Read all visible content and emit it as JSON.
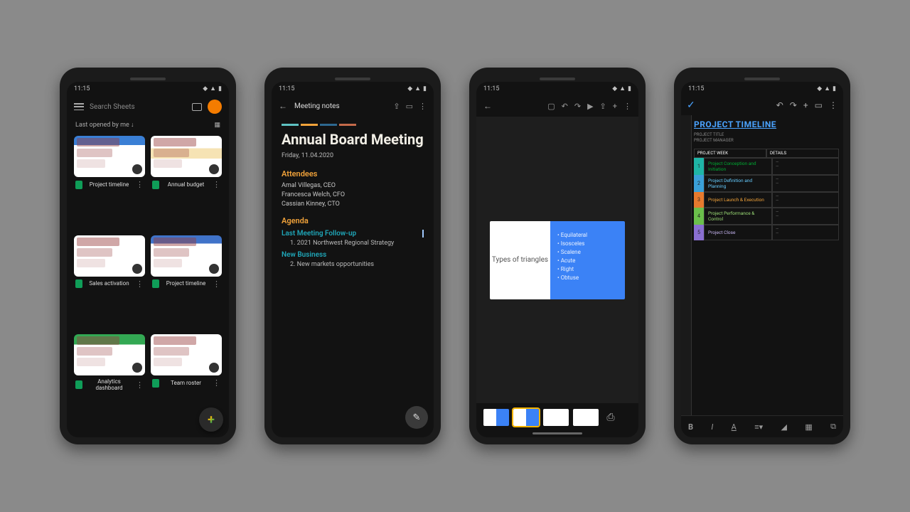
{
  "status": {
    "time": "11:15"
  },
  "phone1": {
    "search_placeholder": "Search Sheets",
    "filter_label": "Last opened by me ↓",
    "files": [
      {
        "name": "Project timeline"
      },
      {
        "name": "Annual budget"
      },
      {
        "name": "Sales activation"
      },
      {
        "name": "Project timeline"
      },
      {
        "name": "Analytics dashboard"
      },
      {
        "name": "Team roster"
      }
    ]
  },
  "phone2": {
    "doc_title": "Meeting notes",
    "heading": "Annual Board Meeting",
    "date": "Friday, 11.04.2020",
    "sections": {
      "attendees_label": "Attendees",
      "attendees": [
        "Amal Villegas, CEO",
        "Francesca Welch, CFO",
        "Cassian Kinney, CTO"
      ],
      "agenda_label": "Agenda",
      "sub1": "Last Meeting Follow-up",
      "item1": "1.   2021 Northwest Regional Strategy",
      "sub2": "New Business",
      "item2": "2.   New markets opportunities"
    }
  },
  "phone3": {
    "slide": {
      "left_title": "Types of triangles",
      "bullets": [
        "Equilateral",
        "Isosceles",
        "Scalene",
        "Acute",
        "Right",
        "Obtuse"
      ]
    }
  },
  "phone4": {
    "title": "PROJECT TIMELINE",
    "meta1": "PROJECT TITLE",
    "meta2": "PROJECT MANAGER",
    "head1": "PROJECT WEEK",
    "head2": "DETAILS",
    "phases": [
      {
        "idx": "1",
        "name": "Project Conception and Initiation",
        "bg": "#1fb5a6",
        "fg": "#0a3"
      },
      {
        "idx": "2",
        "name": "Project Definition and Planning",
        "bg": "#3aa0d8",
        "fg": "#6cf"
      },
      {
        "idx": "3",
        "name": "Project Launch & Execution",
        "bg": "#e67a2e",
        "fg": "#f2a33a"
      },
      {
        "idx": "4",
        "name": "Project Performance & Control",
        "bg": "#6bbf4b",
        "fg": "#9bdc76"
      },
      {
        "idx": "5",
        "name": "Project Close",
        "bg": "#8a6fd1",
        "fg": "#c4b3ef"
      }
    ]
  }
}
